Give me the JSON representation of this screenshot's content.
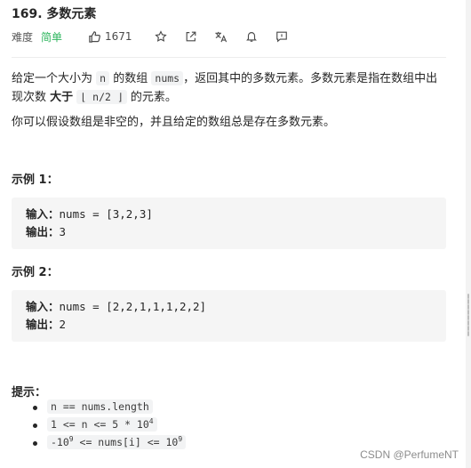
{
  "problem": {
    "title": "169. 多数元素",
    "difficulty_label": "难度",
    "difficulty": "简单",
    "likes": "1671"
  },
  "description": {
    "p1_a": "给定一个大小为",
    "p1_n": "n",
    "p1_b": "的数组",
    "p1_nums": "nums",
    "p1_c": "，返回其中的多数元素。多数元素是指在数组中出现次数",
    "p1_bold": "大于",
    "p1_floor": "⌊ n/2 ⌋",
    "p1_d": "的元素。",
    "p2": "你可以假设数组是非空的，并且给定的数组总是存在多数元素。"
  },
  "examples": [
    {
      "heading": "示例 1：",
      "input_label": "输入：",
      "input": "nums = [3,2,3]",
      "output_label": "输出：",
      "output": "3"
    },
    {
      "heading": "示例 2：",
      "input_label": "输入：",
      "input": "nums = [2,2,1,1,1,2,2]",
      "output_label": "输出：",
      "output": "2"
    }
  ],
  "hints": {
    "heading": "提示：",
    "h1": "n == nums.length",
    "h2_a": "1 <= n <= 5 * 10",
    "h2_exp": "4",
    "h3_a": "-10",
    "h3_exp1": "9",
    "h3_b": " <= nums[i] <= 10",
    "h3_exp2": "9"
  },
  "watermark": "CSDN @PerfumeNT",
  "icons": [
    "thumbs-up-icon",
    "star-icon",
    "share-icon",
    "translate-icon",
    "bell-icon",
    "comment-icon"
  ]
}
